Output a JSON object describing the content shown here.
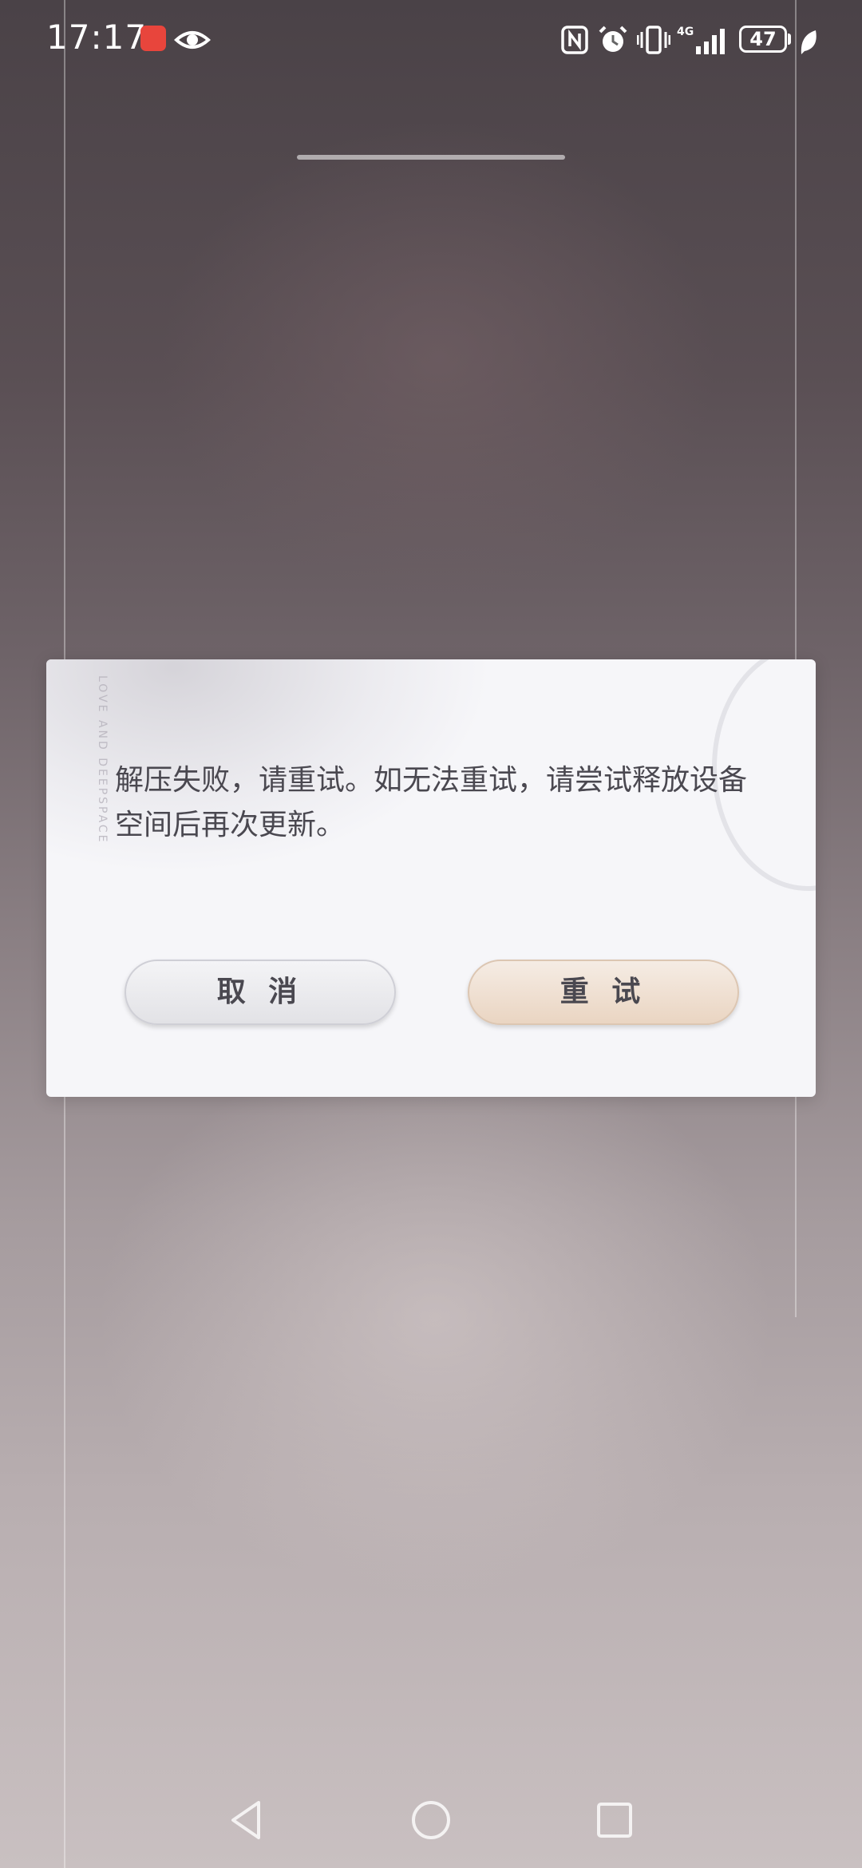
{
  "status_bar": {
    "time": "17:17",
    "battery": "47"
  },
  "dialog": {
    "message": "解压失败，请重试。如无法重试，请尝试释放设备空间后再次更新。",
    "cancel_label": "取 消",
    "retry_label": "重 试",
    "watermark": "LOVE AND DEEPSPACE"
  },
  "colors": {
    "dialog_bg": "#f6f6f9",
    "cancel_btn": "#e8e8ec",
    "retry_btn": "#f0dfcf",
    "text": "#4a4850"
  },
  "icons": {
    "status": [
      "app-badge-icon",
      "eye-icon",
      "nfc-icon",
      "alarm-icon",
      "vibrate-icon",
      "signal-4g-icon",
      "battery-icon",
      "leaf-icon"
    ],
    "nav": [
      "back-icon",
      "home-icon",
      "recents-icon"
    ]
  }
}
